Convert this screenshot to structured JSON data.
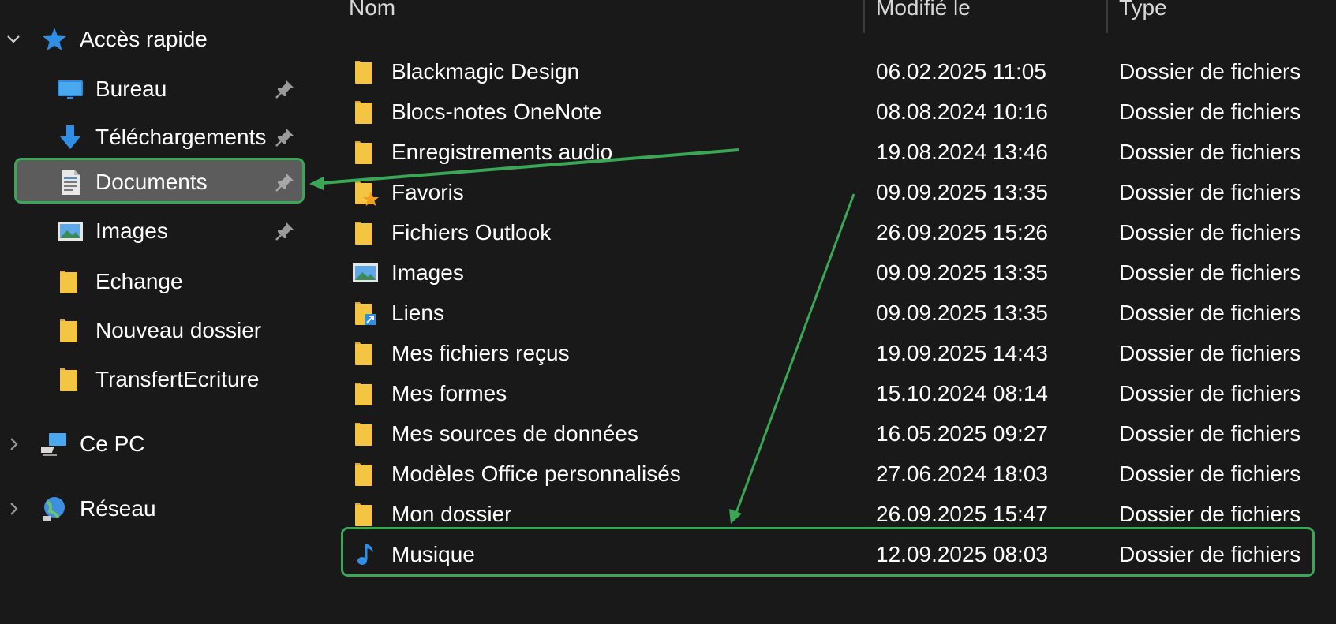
{
  "sidebar": {
    "quick_access": {
      "label": "Accès rapide",
      "icon": "star-icon"
    },
    "items": [
      {
        "label": "Bureau",
        "icon": "desktop-icon",
        "pinned": true
      },
      {
        "label": "Téléchargements",
        "icon": "download-icon",
        "pinned": true
      },
      {
        "label": "Documents",
        "icon": "documents-icon",
        "pinned": true,
        "selected": true
      },
      {
        "label": "Images",
        "icon": "images-icon",
        "pinned": true
      },
      {
        "label": "Echange",
        "icon": "folder-icon",
        "pinned": false
      },
      {
        "label": "Nouveau dossier",
        "icon": "folder-icon",
        "pinned": false
      },
      {
        "label": "TransfertEcriture",
        "icon": "folder-icon",
        "pinned": false
      }
    ],
    "this_pc": {
      "label": "Ce PC",
      "icon": "computer-icon"
    },
    "network": {
      "label": "Réseau",
      "icon": "network-icon"
    }
  },
  "columns": {
    "name": "Nom",
    "modified": "Modifié le",
    "type": "Type"
  },
  "files": [
    {
      "name": "Blackmagic Design",
      "date": "06.02.2025 11:05",
      "type": "Dossier de fichiers",
      "icon": "folder-icon"
    },
    {
      "name": "Blocs-notes OneNote",
      "date": "08.08.2024 10:16",
      "type": "Dossier de fichiers",
      "icon": "folder-icon"
    },
    {
      "name": "Enregistrements audio",
      "date": "19.08.2024 13:46",
      "type": "Dossier de fichiers",
      "icon": "folder-icon"
    },
    {
      "name": "Favoris",
      "date": "09.09.2025 13:35",
      "type": "Dossier de fichiers",
      "icon": "favorites-folder-icon"
    },
    {
      "name": "Fichiers Outlook",
      "date": "26.09.2025 15:26",
      "type": "Dossier de fichiers",
      "icon": "folder-icon"
    },
    {
      "name": "Images",
      "date": "09.09.2025 13:35",
      "type": "Dossier de fichiers",
      "icon": "images-icon"
    },
    {
      "name": "Liens",
      "date": "09.09.2025 13:35",
      "type": "Dossier de fichiers",
      "icon": "links-folder-icon"
    },
    {
      "name": "Mes fichiers reçus",
      "date": "19.09.2025 14:43",
      "type": "Dossier de fichiers",
      "icon": "folder-icon"
    },
    {
      "name": "Mes formes",
      "date": "15.10.2024 08:14",
      "type": "Dossier de fichiers",
      "icon": "folder-icon"
    },
    {
      "name": "Mes sources de données",
      "date": "16.05.2025 09:27",
      "type": "Dossier de fichiers",
      "icon": "folder-icon"
    },
    {
      "name": "Modèles Office personnalisés",
      "date": "27.06.2024 18:03",
      "type": "Dossier de fichiers",
      "icon": "folder-icon"
    },
    {
      "name": "Mon dossier",
      "date": "26.09.2025 15:47",
      "type": "Dossier de fichiers",
      "icon": "folder-icon",
      "highlighted": true
    },
    {
      "name": "Musique",
      "date": "12.09.2025 08:03",
      "type": "Dossier de fichiers",
      "icon": "music-icon"
    }
  ],
  "colors": {
    "background": "#191919",
    "selection": "#5c5c5c",
    "annotation_green": "#3aa757",
    "folder_yellow": "#f4c542"
  }
}
